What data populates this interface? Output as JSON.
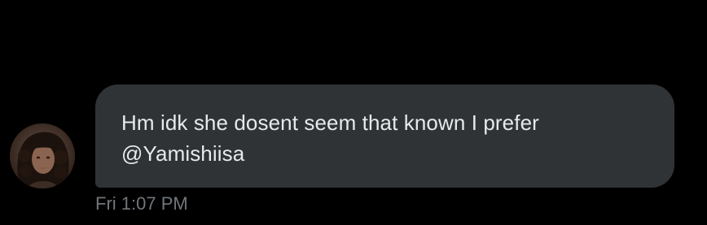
{
  "conversation": {
    "message": {
      "text_line_1": "Hm idk she dosent seem that known I prefer",
      "text_line_2": "@Yamishiisa",
      "timestamp": "Fri 1:07 PM"
    },
    "sender": {
      "avatar_icon": "user-avatar"
    }
  },
  "colors": {
    "background": "#000000",
    "bubble": "#2f3336",
    "text": "#e7e9ea",
    "timestamp": "#71767b"
  }
}
